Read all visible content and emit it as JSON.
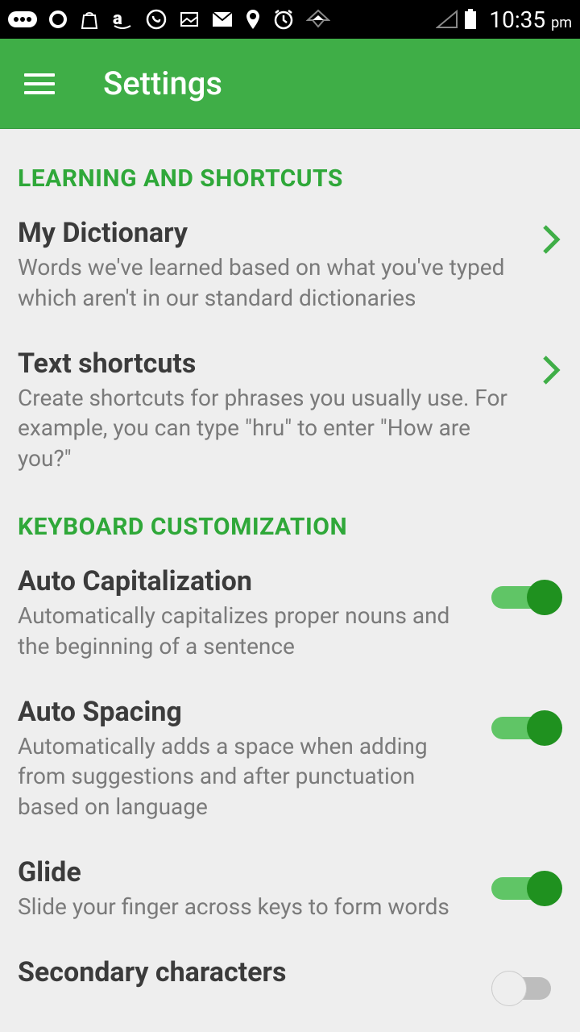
{
  "status_bar": {
    "time": "10:35",
    "ampm": "pm"
  },
  "app_bar": {
    "title": "Settings"
  },
  "sections": {
    "learning": {
      "header": "LEARNING AND SHORTCUTS",
      "items": [
        {
          "title": "My Dictionary",
          "desc": "Words we've learned based on what you've typed which aren't in our standard dictionaries"
        },
        {
          "title": "Text shortcuts",
          "desc": "Create shortcuts for phrases you usually use. For example, you can type \"hru\" to enter \"How are you?\""
        }
      ]
    },
    "keyboard": {
      "header": "KEYBOARD CUSTOMIZATION",
      "items": [
        {
          "title": "Auto Capitalization",
          "desc": "Automatically capitalizes proper nouns and the beginning of a sentence",
          "on": true
        },
        {
          "title": "Auto Spacing",
          "desc": "Automatically adds a space when adding from suggestions and after punctuation based on language",
          "on": true
        },
        {
          "title": "Glide",
          "desc": "Slide your finger across keys to form words",
          "on": true
        },
        {
          "title": "Secondary characters",
          "desc": "",
          "on": false
        }
      ]
    }
  }
}
